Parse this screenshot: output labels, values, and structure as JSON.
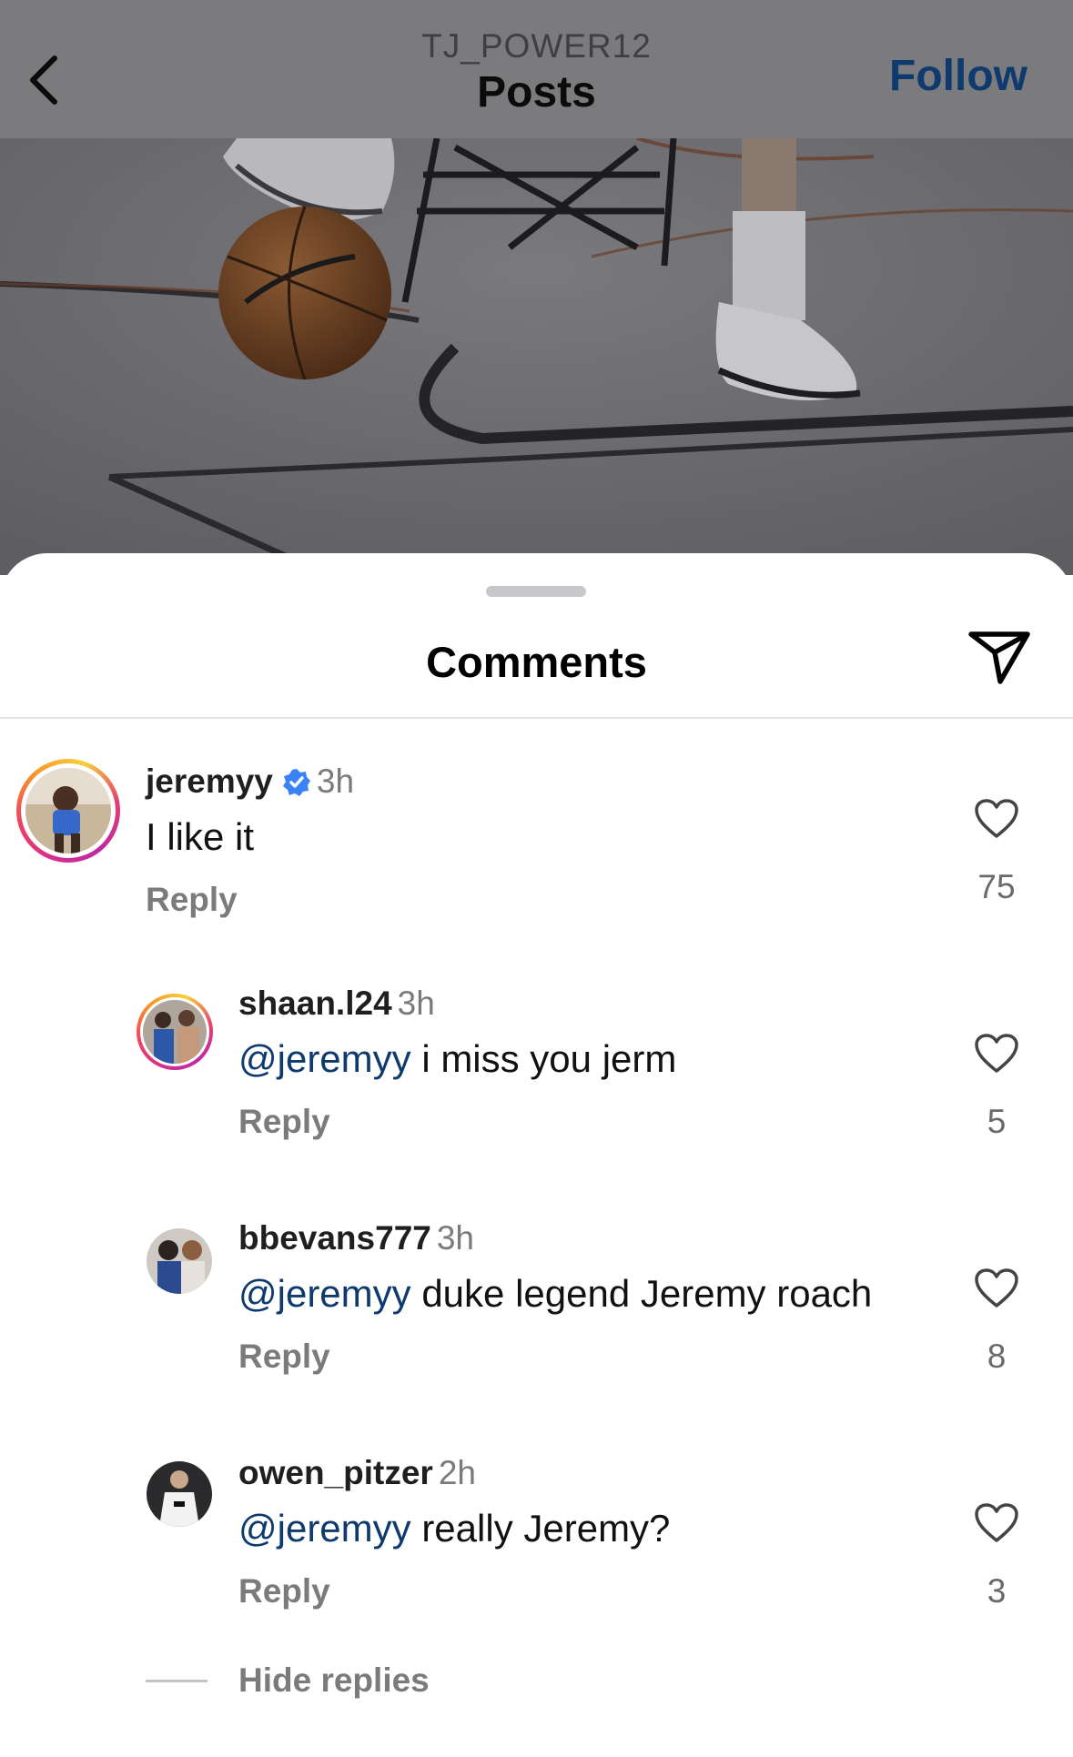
{
  "header": {
    "account": "TJ_POWER12",
    "title": "Posts",
    "follow_label": "Follow"
  },
  "sheet": {
    "title": "Comments"
  },
  "comments": [
    {
      "username": "jeremyy",
      "verified": true,
      "time": "3h",
      "mention": "",
      "text": "I like it",
      "reply_label": "Reply",
      "likes": "75"
    },
    {
      "username": "shaan.l24",
      "verified": false,
      "time": "3h",
      "mention": "@jeremyy",
      "text": " i miss you jerm",
      "reply_label": "Reply",
      "likes": "5"
    },
    {
      "username": "bbevans777",
      "verified": false,
      "time": "3h",
      "mention": "@jeremyy",
      "text": " duke legend Jeremy roach",
      "reply_label": "Reply",
      "likes": "8"
    },
    {
      "username": "owen_pitzer",
      "verified": false,
      "time": "2h",
      "mention": "@jeremyy",
      "text": " really Jeremy?",
      "reply_label": "Reply",
      "likes": "3"
    }
  ],
  "hide_replies_label": "Hide replies",
  "colors": {
    "mention": "#0e3a6e",
    "verified": "#3b82f6",
    "muted": "#7b7b7d"
  },
  "icons": [
    "chevron-left-icon",
    "paper-plane-icon",
    "heart-outline-icon",
    "verified-badge-icon"
  ]
}
